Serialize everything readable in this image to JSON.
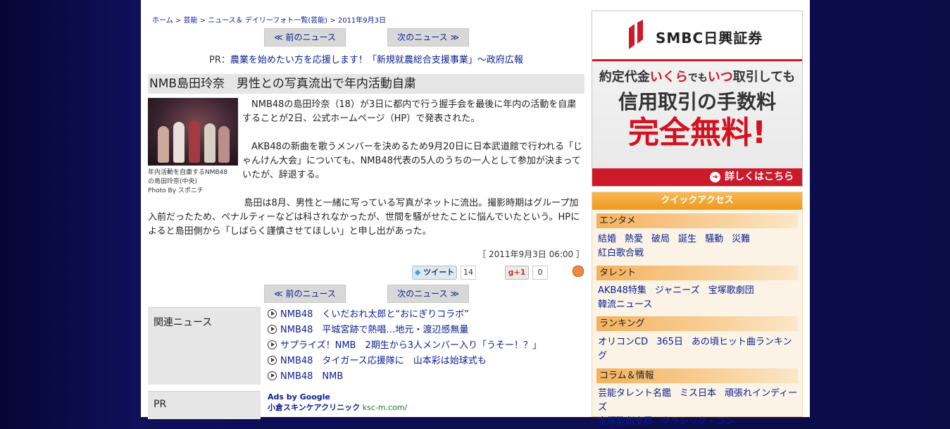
{
  "breadcrumb": {
    "items": [
      "ホーム",
      "芸能",
      "ニュース＆ デイリーフォト一覧(芸能)"
    ],
    "sep": " > ",
    "current": "2011年9月3日"
  },
  "nav": {
    "prev": "≪ 前のニュース",
    "next": "次のニュース ≫"
  },
  "pr": {
    "prefix": "PR：",
    "link": "農業を始めたい方を応援します！「新規就農総合支援事業」～政府広報"
  },
  "article": {
    "headline": "NMB島田玲奈　男性との写真流出で年内活動自粛",
    "caption": [
      "年内活動を自粛するNMB48",
      "の島田玲奈(中央)",
      "Photo By スポニチ"
    ],
    "paragraphs": [
      "NMB48の島田玲奈（18）が3日に都内で行う握手会を最後に年内の活動を自粛することが2日、公式ホームページ（HP）で発表された。",
      "AKB48の新曲を歌うメンバーを決めるため9月20日に日本武道館で行われる「じゃんけん大会」についても、NMB48代表の5人のうちの一人として参加が決まっていたが、辞退する。",
      "島田は8月、男性と一緒に写っている写真がネットに流出。撮影時期はグループ加入前だったため、ペナルティーなどは科されなかったが、世間を騒がせたことに悩んでいたという。HPによると島田側から「しばらく謹慎させてほしい」と申し出があった。"
    ],
    "date": "［ 2011年9月3日 06:00 ］"
  },
  "social": {
    "tweet_label": "ツイート",
    "tweet_count": "14",
    "gplus_label": "+1",
    "gplus_count": "0"
  },
  "related": {
    "title": "関連ニュース",
    "items": [
      "NMB48　くいだおれ太郎と“おにぎりコラボ”",
      "NMB48　平城宮跡で熱唱…地元・渡辺感無量",
      "サプライズ！NMB　2期生から3人メンバー入り「うそー！？」",
      "NMB48　タイガース応援隊に　山本彩は始球式も",
      "NMB48　NMB"
    ]
  },
  "pr_section": {
    "title": "PR",
    "ads_by": "Ads by Google",
    "ad_name": "小倉スキンケアクリニック",
    "ad_url": "ksc-m.com/"
  },
  "banner": {
    "brand": "SMBC日興証券",
    "line1_pre": "約定代金",
    "line1_red1": "いくら",
    "line1_mid": "でも",
    "line1_red2": "いつ",
    "line1_post": "取引しても",
    "line2": "信用取引の手数料",
    "line3": "完全無料!",
    "cta": "詳しくはこちら",
    "accent": "#cc1a2a"
  },
  "quick_access": {
    "title": "クイックアクセス",
    "categories": [
      {
        "label": "エンタメ",
        "links": [
          "結婚",
          "熱愛",
          "破局",
          "誕生",
          "騒動",
          "災難",
          "紅白歌合戦"
        ]
      },
      {
        "label": "タレント",
        "links": [
          "AKB48特集",
          "ジャニーズ",
          "宝塚歌劇団",
          "韓流ニュース"
        ]
      },
      {
        "label": "ランキング",
        "links": [
          "オリコンCD",
          "365日",
          "あの頃ヒット曲ランキング"
        ]
      },
      {
        "label": "コラム＆情報",
        "links": [
          "芸能タレント名鑑",
          "ミス日本",
          "頑張れインディーズ",
          "宝塚歌劇支局",
          "クラシック・コン"
        ]
      }
    ]
  }
}
